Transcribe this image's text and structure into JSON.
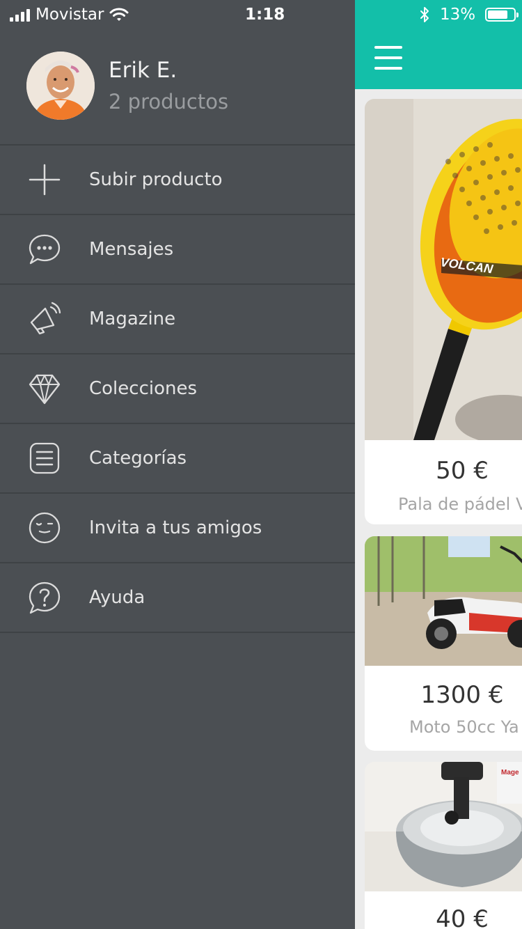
{
  "status_bar": {
    "carrier": "Movistar",
    "time": "1:18",
    "battery": "13%",
    "battery_level": 0.13
  },
  "profile": {
    "name": "Erik E.",
    "subtitle": "2 productos"
  },
  "menu": [
    {
      "label": "Subir producto",
      "icon": "plus-icon"
    },
    {
      "label": "Mensajes",
      "icon": "chat-bubble-icon"
    },
    {
      "label": "Magazine",
      "icon": "megaphone-icon"
    },
    {
      "label": "Colecciones",
      "icon": "diamond-icon"
    },
    {
      "label": "Categorías",
      "icon": "list-icon"
    },
    {
      "label": "Invita a tus amigos",
      "icon": "wink-face-icon"
    },
    {
      "label": "Ayuda",
      "icon": "help-bubble-icon"
    }
  ],
  "listings": [
    {
      "price": "50 €",
      "title": "Pala de pádel Vo"
    },
    {
      "price": "1300 €",
      "title": "Moto 50cc Ya"
    },
    {
      "price": "40 €",
      "title": ""
    }
  ],
  "colors": {
    "drawer_bg": "#4b4f53",
    "accent": "#13bfa9",
    "divider": "#3e4245"
  }
}
